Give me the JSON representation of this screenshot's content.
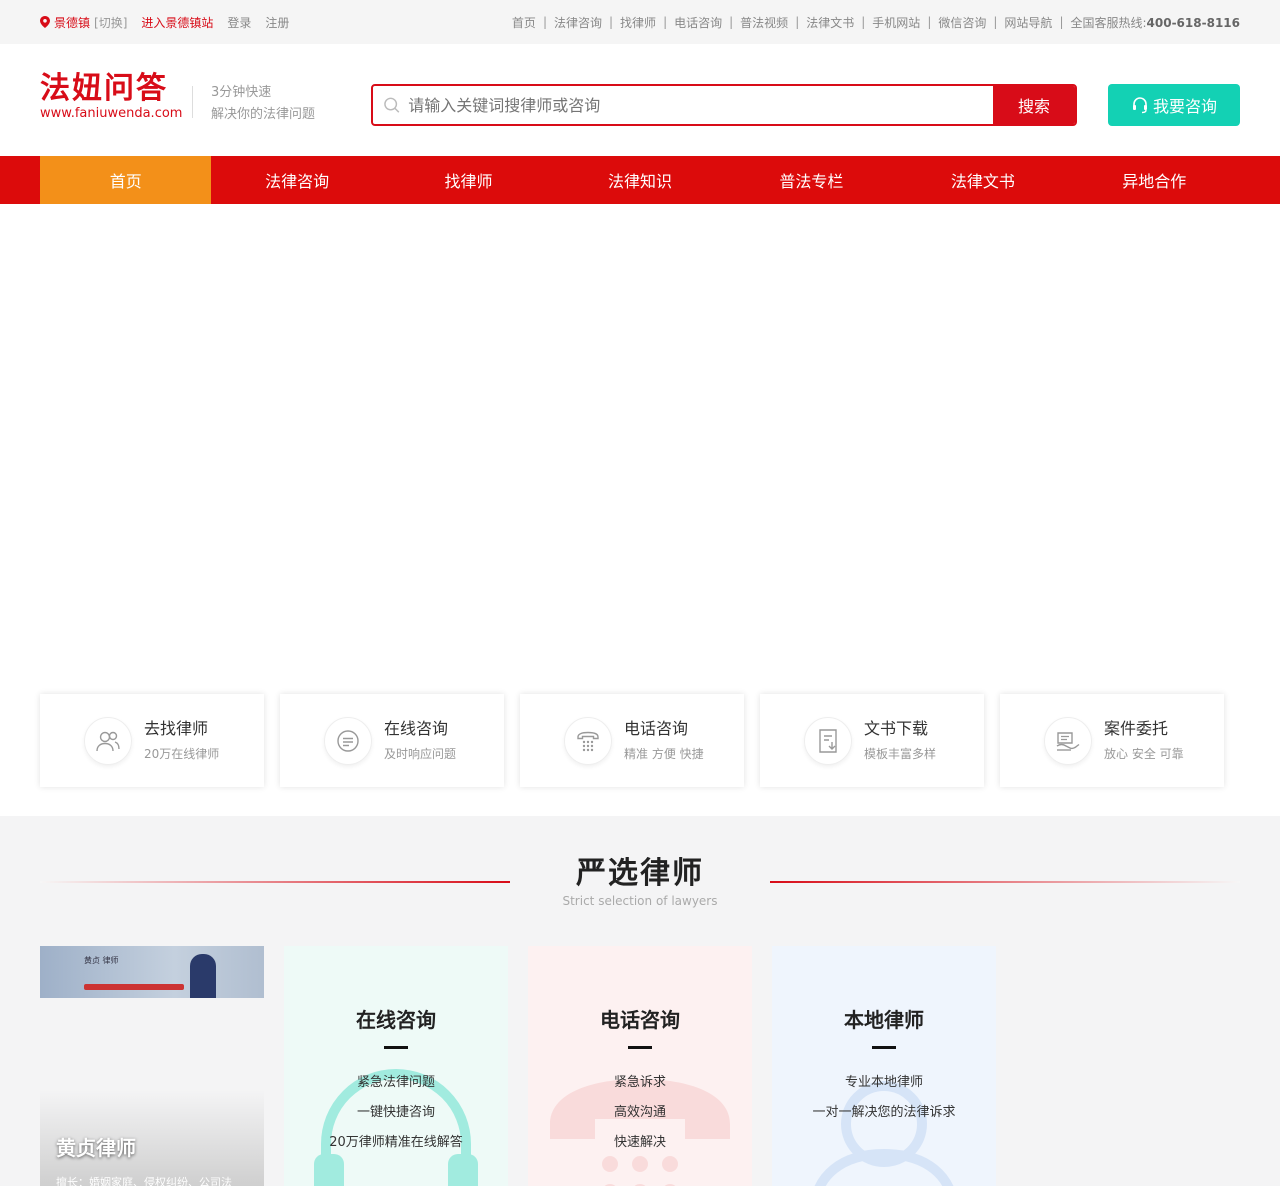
{
  "topbar": {
    "city": "景德镇",
    "switch": "[切换]",
    "enter_station": "进入景德镇站",
    "login": "登录",
    "register": "注册",
    "links": [
      "首页",
      "法律咨询",
      "找律师",
      "电话咨询",
      "普法视频",
      "法律文书",
      "手机网站",
      "微信咨询",
      "网站导航"
    ],
    "hotline_label": "全国客服热线:",
    "hotline_number": "400-618-8116"
  },
  "header": {
    "logo_name": "法妞问答",
    "logo_url": "www.faniuwenda.com",
    "slogan_line1": "3分钟快速",
    "slogan_line2": "解决你的法律问题",
    "search_placeholder": "请输入关键词搜律师或咨询",
    "search_button": "搜索",
    "consult_button": "我要咨询"
  },
  "nav": {
    "items": [
      "首页",
      "法律咨询",
      "找律师",
      "法律知识",
      "普法专栏",
      "法律文书",
      "异地合作"
    ],
    "active_index": 0
  },
  "services": [
    {
      "title": "去找律师",
      "sub": "20万在线律师",
      "icon": "users-icon"
    },
    {
      "title": "在线咨询",
      "sub": "及时响应问题",
      "icon": "chat-icon"
    },
    {
      "title": "电话咨询",
      "sub": "精准 方便 快捷",
      "icon": "phone-icon"
    },
    {
      "title": "文书下载",
      "sub": "模板丰富多样",
      "icon": "download-icon"
    },
    {
      "title": "案件委托",
      "sub": "放心 安全 可靠",
      "icon": "handshake-icon"
    }
  ],
  "lawyers_section": {
    "title": "严选律师",
    "subtitle": "Strict selection of lawyers",
    "lawyer_card": {
      "name": "黄贞律师",
      "banner_text": "黄贞 律师",
      "desc": "擅长：婚姻家庭、侵权纠纷、公司法"
    },
    "feature_cards": [
      {
        "title": "在线咨询",
        "lines": [
          "紧急法律问题",
          "一键快捷咨询",
          "20万律师精准在线解答"
        ]
      },
      {
        "title": "电话咨询",
        "lines": [
          "紧急诉求",
          "高效沟通",
          "快速解决"
        ]
      },
      {
        "title": "本地律师",
        "lines": [
          "专业本地律师",
          "一对一解决您的法律诉求"
        ]
      }
    ]
  },
  "colors": {
    "brand_red": "#d80c18",
    "nav_red": "#dc0b0b",
    "nav_active": "#f39019",
    "consult_green": "#13d1b4"
  }
}
